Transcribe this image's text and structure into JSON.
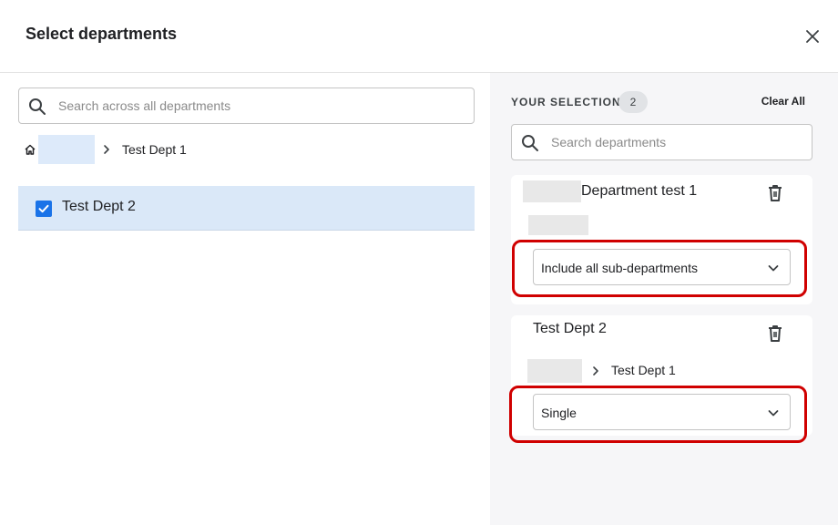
{
  "header": {
    "title": "Select departments",
    "close_icon": "close-icon"
  },
  "left": {
    "search": {
      "value": "",
      "placeholder": "Search across all departments"
    },
    "breadcrumb": {
      "home_icon": "home-icon",
      "current": "Test Dept 1"
    },
    "results": [
      {
        "label": "Test Dept 2",
        "checked": true
      }
    ]
  },
  "right": {
    "selection_label": "YOUR SELECTION",
    "selection_count": "2",
    "clear_all": "Clear All",
    "search": {
      "value": "",
      "placeholder": "Search departments"
    },
    "cards": [
      {
        "title": "Department test 1",
        "dropdown": "Include all sub-departments"
      },
      {
        "title": "Test Dept 2",
        "path_label": "Test Dept 1",
        "dropdown": "Single"
      }
    ]
  },
  "colors": {
    "accent": "#1a73e8",
    "selected_row": "#dae8f8",
    "highlight": "#d00000",
    "panel_bg": "#f6f6f8"
  }
}
